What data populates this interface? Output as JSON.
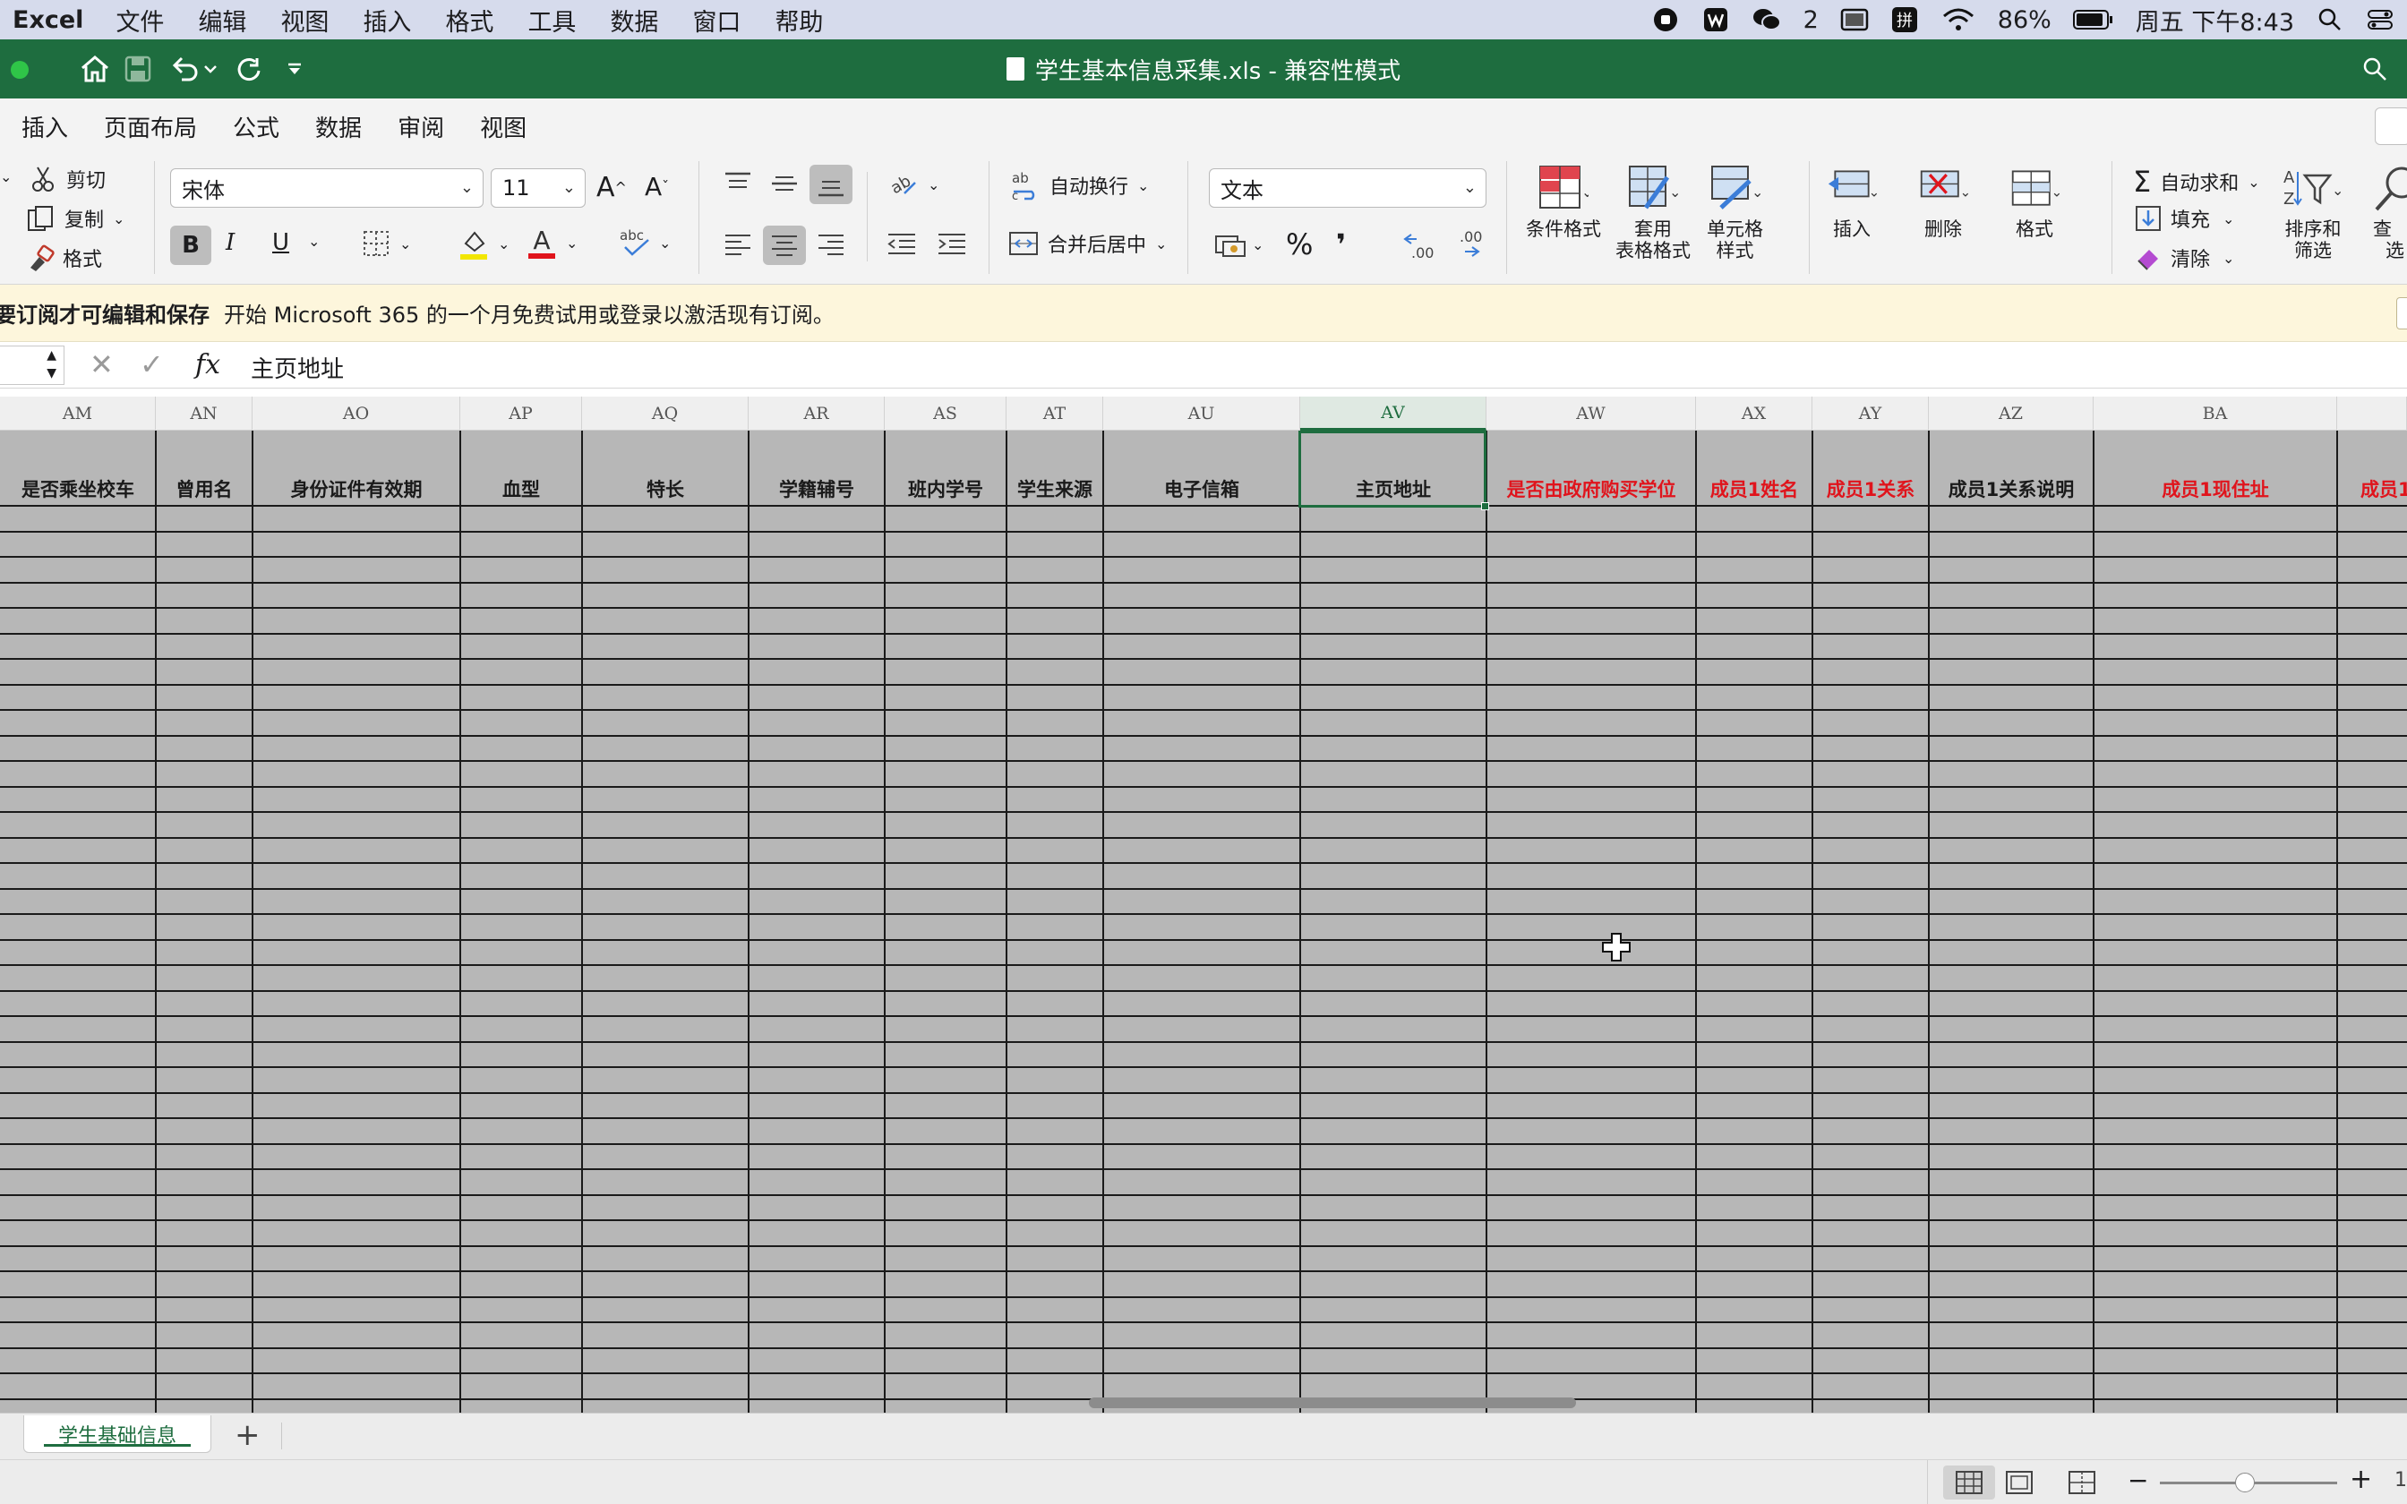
{
  "menubar": {
    "app": "Excel",
    "items": [
      "文件",
      "编辑",
      "视图",
      "插入",
      "格式",
      "工具",
      "数据",
      "窗口",
      "帮助"
    ],
    "wechat_count": "2",
    "battery": "86%",
    "clock": "周五 下午8:43"
  },
  "titlebar": {
    "title": "学生基本信息采集.xls  -  兼容性模式"
  },
  "tabs": [
    "插入",
    "页面布局",
    "公式",
    "数据",
    "审阅",
    "视图"
  ],
  "ribbon": {
    "cut": "剪切",
    "copy": "复制",
    "format_painter": "格式",
    "font_name": "宋体",
    "font_size": "11",
    "bold": "B",
    "italic": "I",
    "underline": "U",
    "wrap_text": "自动换行",
    "merge_center": "合并后居中",
    "number_format": "文本",
    "percent": "%",
    "comma": "❜",
    "conditional_format": "条件格式",
    "table_format_1": "套用",
    "table_format_2": "表格格式",
    "cell_style_1": "单元格",
    "cell_style_2": "样式",
    "insert": "插入",
    "delete": "删除",
    "format": "格式",
    "autosum": "自动求和",
    "fill": "填充",
    "clear": "清除",
    "sort_filter_1": "排序和",
    "sort_filter_2": "筛选",
    "find_1": "查",
    "find_2": "选"
  },
  "notice": {
    "bold": "要订阅才可编辑和保存",
    "text": "开始 Microsoft 365 的一个月免费试用或登录以激活现有订阅。"
  },
  "formula": {
    "fx": "fx",
    "value": "主页地址"
  },
  "columns": [
    {
      "letter": "AM",
      "header": "是否乘坐校车",
      "red": false
    },
    {
      "letter": "AN",
      "header": "曾用名",
      "red": false
    },
    {
      "letter": "AO",
      "header": "身份证件有效期",
      "red": false
    },
    {
      "letter": "AP",
      "header": "血型",
      "red": false
    },
    {
      "letter": "AQ",
      "header": "特长",
      "red": false
    },
    {
      "letter": "AR",
      "header": "学籍辅号",
      "red": false
    },
    {
      "letter": "AS",
      "header": "班内学号",
      "red": false
    },
    {
      "letter": "AT",
      "header": "学生来源",
      "red": false
    },
    {
      "letter": "AU",
      "header": "电子信箱",
      "red": false
    },
    {
      "letter": "AV",
      "header": "主页地址",
      "red": false,
      "selected": true
    },
    {
      "letter": "AW",
      "header": "是否由政府购买学位",
      "red": true
    },
    {
      "letter": "AX",
      "header": "成员1姓名",
      "red": true
    },
    {
      "letter": "AY",
      "header": "成员1关系",
      "red": true
    },
    {
      "letter": "AZ",
      "header": "成员1关系说明",
      "red": false
    },
    {
      "letter": "BA",
      "header": "成员1现住址",
      "red": true
    },
    {
      "letter": "",
      "header": "成员1",
      "red": true
    }
  ],
  "sheet": {
    "name": "学生基础信息",
    "add": "+"
  },
  "status": {
    "zoom_minus": "−",
    "zoom_plus": "+",
    "zoom_level": "1"
  }
}
